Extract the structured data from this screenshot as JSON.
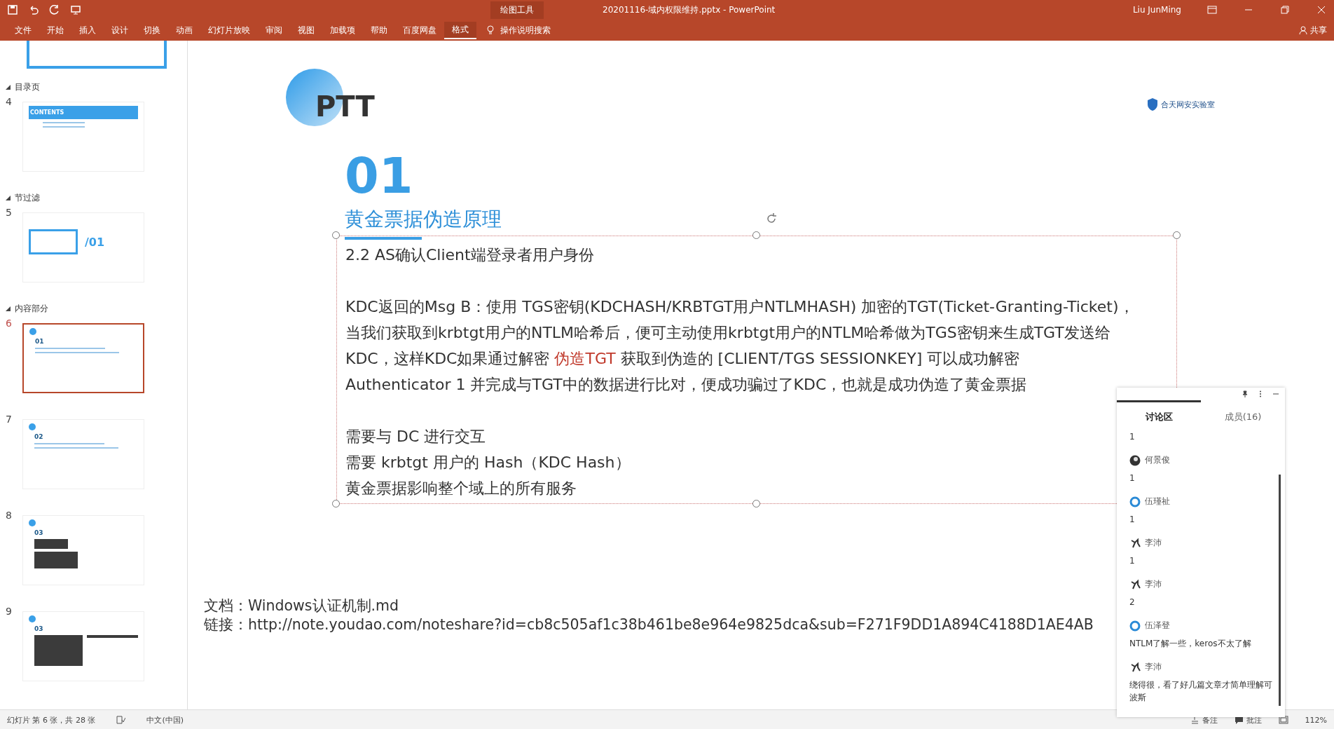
{
  "title_bar": {
    "context_label": "绘图工具",
    "document_title": "20201116-域内权限维持.pptx  -  PowerPoint",
    "user": "Liu JunMing"
  },
  "menu": [
    {
      "label": "文件",
      "selected": false
    },
    {
      "label": "开始",
      "selected": false
    },
    {
      "label": "插入",
      "selected": false
    },
    {
      "label": "设计",
      "selected": false
    },
    {
      "label": "切换",
      "selected": false
    },
    {
      "label": "动画",
      "selected": false
    },
    {
      "label": "幻灯片放映",
      "selected": false
    },
    {
      "label": "审阅",
      "selected": false
    },
    {
      "label": "视图",
      "selected": false
    },
    {
      "label": "加载项",
      "selected": false
    },
    {
      "label": "帮助",
      "selected": false
    },
    {
      "label": "百度网盘",
      "selected": false
    },
    {
      "label": "格式",
      "selected": true
    }
  ],
  "search_hint": "操作说明搜索",
  "share": "共享",
  "sections": [
    {
      "title": "目录页",
      "slides": [
        {
          "number": "4",
          "kind": "contents",
          "heading": "CONTENTS",
          "selected": false
        }
      ]
    },
    {
      "title": "节过滤",
      "slides": [
        {
          "number": "5",
          "kind": "section",
          "heading": "/01",
          "selected": false
        }
      ]
    },
    {
      "title": "内容部分",
      "slides": [
        {
          "number": "6",
          "kind": "text",
          "heading": "01",
          "selected": true
        },
        {
          "number": "7",
          "kind": "text",
          "heading": "02",
          "selected": false
        },
        {
          "number": "8",
          "kind": "images",
          "heading": "03",
          "selected": false
        },
        {
          "number": "9",
          "kind": "split",
          "heading": "03",
          "selected": false
        }
      ]
    }
  ],
  "slide": {
    "header": "PTT",
    "brand": "合天网安实验室",
    "chapter": "01",
    "title": "黄金票据伪造原理",
    "body": [
      [
        [
          {
            "text": "2.2 AS确认Client端登录者用户身份"
          }
        ]
      ],
      [
        [
          {
            "text": "KDC返回的Msg B：使用 TGS密钥(KDCHASH/KRBTGT用户NTLMHASH) 加密的TGT(Ticket-Granting-Ticket)，"
          }
        ],
        [
          {
            "text": "当我们获取到krbtgt用户的NTLM哈希后，便可主动使用krbtgt用户的NTLM哈希做为TGS密钥来生成TGT发送给"
          }
        ],
        [
          {
            "text": "KDC，这样KDC如果通过解密 "
          },
          {
            "text": "伪造TGT",
            "kind": "highlight"
          },
          {
            "text": " 获取到伪造的 [CLIENT/TGS SESSIONKEY] 可以成功解密"
          }
        ],
        [
          {
            "text": "Authenticator 1 并完成与TGT中的数据进行比对，便成功骗过了KDC，也就是成功伪造了黄金票据"
          }
        ]
      ],
      [
        [
          {
            "text": "需要与 DC 进行交互"
          }
        ],
        [
          {
            "text": "需要 krbtgt 用户的 Hash（KDC Hash）"
          }
        ],
        [
          {
            "text": "黄金票据影响整个域上的所有服务"
          }
        ]
      ]
    ],
    "document": "文档：Windows认证机制.md",
    "link": "链接：http://note.youdao.com/noteshare?id=cb8c505af1c38b461be8e964e9825dca&sub=F271F9DD1A894C4188D1AE4AB"
  },
  "chat": {
    "tabs": [
      {
        "label": "讨论区",
        "selected": true
      },
      {
        "label": "成员(16)",
        "selected": false
      }
    ],
    "messages": [
      {
        "text": "1"
      },
      {
        "name": "何景俊",
        "kind": "dark",
        "text": "1"
      },
      {
        "name": "伍瑾祉",
        "kind": "ring",
        "text": "1"
      },
      {
        "name": "李沛",
        "kind": "figure",
        "text": "1"
      },
      {
        "name": "李沛",
        "kind": "figure",
        "text": "2"
      },
      {
        "name": "伍泽登",
        "kind": "ring",
        "text": "NTLM了解一些，keros不太了解"
      },
      {
        "name": "李沛",
        "kind": "figure",
        "text": "绕得很，看了好几篇文章才简单理解可波斯"
      }
    ]
  },
  "status_bar": {
    "slide_info": "幻灯片 第 6 张，共 28 张",
    "language": "中文(中国)",
    "notes": "备注",
    "comments": "批注",
    "zoom": "112%"
  }
}
